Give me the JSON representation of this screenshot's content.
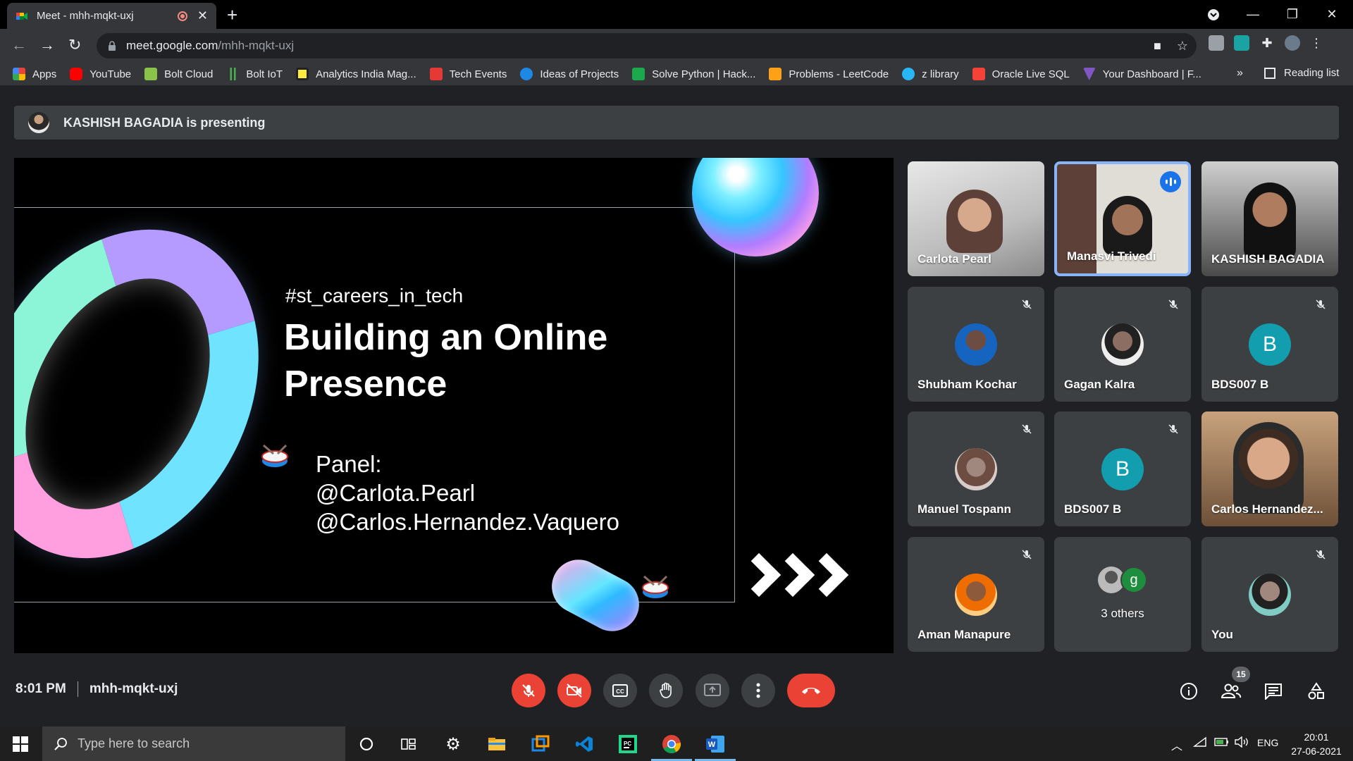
{
  "browser": {
    "tab_title": "Meet - mhh-mqkt-uxj",
    "url_host": "meet.google.com",
    "url_path": "/mhh-mqkt-uxj",
    "bookmarks": [
      {
        "label": "Apps",
        "icon": "apps-grid-icon",
        "color": "#4285f4"
      },
      {
        "label": "YouTube",
        "icon": "youtube-icon",
        "color": "#ff0000"
      },
      {
        "label": "Bolt Cloud",
        "icon": "bolt-cloud-icon",
        "color": "#8bc34a"
      },
      {
        "label": "Bolt IoT",
        "icon": "bolt-iot-icon",
        "color": "#4caf50"
      },
      {
        "label": "Analytics India Mag...",
        "icon": "analytics-india-icon",
        "color": "#ffeb3b"
      },
      {
        "label": "Tech Events",
        "icon": "tech-events-icon",
        "color": "#e53935"
      },
      {
        "label": "Ideas of Projects",
        "icon": "ideas-icon",
        "color": "#1e88e5"
      },
      {
        "label": "Solve Python | Hack...",
        "icon": "hackerrank-icon",
        "color": "#1ba94c"
      },
      {
        "label": "Problems - LeetCode",
        "icon": "leetcode-icon",
        "color": "#ffa116"
      },
      {
        "label": "z library",
        "icon": "zlibrary-icon",
        "color": "#29b6f6"
      },
      {
        "label": "Oracle Live SQL",
        "icon": "oracle-icon",
        "color": "#f44336"
      },
      {
        "label": "Your Dashboard | F...",
        "icon": "dashboard-icon",
        "color": "#7e57c2"
      }
    ],
    "reading_list": "Reading list",
    "more": "»"
  },
  "meet": {
    "presenting_text": "KASHISH BAGADIA is presenting",
    "slide": {
      "hashtag": "#st_careers_in_tech",
      "heading": "Building an Online Presence",
      "panel_label": "Panel:",
      "panelist_1": "@Carlota.Pearl",
      "panelist_2": "@Carlos.Hernandez.Vaquero"
    },
    "participants": [
      {
        "name": "Carlota Pearl",
        "type": "video"
      },
      {
        "name": "Manasvi Trivedi",
        "type": "video",
        "speaking": true
      },
      {
        "name": "KASHISH BAGADIA",
        "type": "video"
      },
      {
        "name": "Shubham Kochar",
        "type": "avatar",
        "muted": true
      },
      {
        "name": "Gagan Kalra",
        "type": "avatar",
        "muted": true
      },
      {
        "name": "BDS007 B",
        "type": "letter",
        "letter": "B",
        "muted": true
      },
      {
        "name": "Manuel Tospann",
        "type": "avatar",
        "muted": true
      },
      {
        "name": "BDS007 B",
        "type": "letter",
        "letter": "B",
        "muted": true
      },
      {
        "name": "Carlos Hernandez...",
        "type": "video"
      },
      {
        "name": "Aman Manapure",
        "type": "avatar",
        "muted": true
      },
      {
        "name": "3 others",
        "type": "others",
        "letter": "g"
      },
      {
        "name": "You",
        "type": "avatar",
        "muted": true
      }
    ],
    "time": "8:01 PM",
    "meeting_code": "mhh-mqkt-uxj",
    "people_count": "15",
    "colors": {
      "accent_red": "#ea4335",
      "tile_bg": "#3c4043",
      "letter_avatar": "#129eaf",
      "speaking_blue": "#1a73e8"
    }
  },
  "taskbar": {
    "search_placeholder": "Type here to search",
    "language": "ENG",
    "time": "20:01",
    "date": "27-06-2021"
  }
}
